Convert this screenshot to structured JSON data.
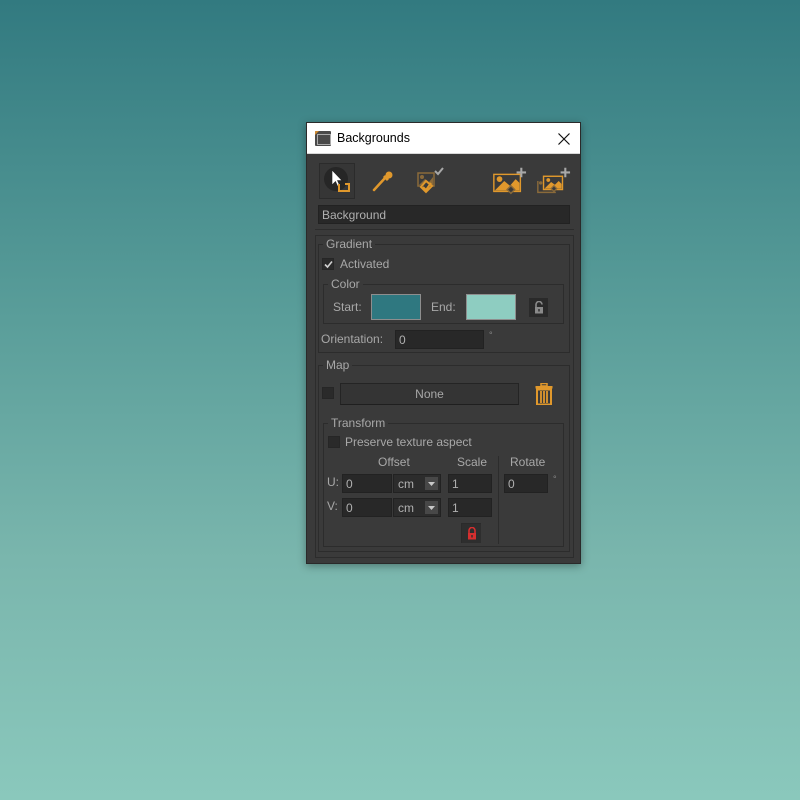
{
  "window": {
    "title": "Backgrounds",
    "close_icon": "close-icon",
    "app_icon": "backgrounds-app-icon"
  },
  "toolbar": {
    "tools": [
      {
        "name": "select-tool",
        "icon": "cursor-select-icon",
        "active": true
      },
      {
        "name": "eyedropper-tool",
        "icon": "eyedropper-icon",
        "active": false
      },
      {
        "name": "apply-background-tool",
        "icon": "image-check-icon",
        "active": false,
        "disabled": true
      },
      {
        "name": "add-background-tool",
        "icon": "image-add-icon",
        "active": false
      },
      {
        "name": "add-multiple-backgrounds-tool",
        "icon": "images-add-icon",
        "active": false
      }
    ],
    "accent_color": "#e0982c"
  },
  "name_field": {
    "value": "Background"
  },
  "gradient": {
    "label": "Gradient",
    "activated_label": "Activated",
    "activated": true,
    "color": {
      "label": "Color",
      "start_label": "Start:",
      "start_color": "#2f7880",
      "end_label": "End:",
      "end_color": "#8ecdc1",
      "lock_state": "unlocked"
    },
    "orientation_label": "Orientation:",
    "orientation_value": "0",
    "orientation_unit": "°"
  },
  "map": {
    "label": "Map",
    "enabled": false,
    "button_label": "None",
    "delete_icon": "trash-icon",
    "transform": {
      "label": "Transform",
      "preserve_label": "Preserve texture aspect",
      "preserve_checked": false,
      "headers": {
        "offset": "Offset",
        "scale": "Scale",
        "rotate": "Rotate"
      },
      "u_label": "U:",
      "v_label": "V:",
      "u_offset": "0",
      "u_unit": "cm",
      "u_scale": "1",
      "v_offset": "0",
      "v_unit": "cm",
      "v_scale": "1",
      "rotate": "0",
      "rotate_unit": "°",
      "scale_lock_state": "locked",
      "lock_color": "#d62f2f"
    }
  }
}
